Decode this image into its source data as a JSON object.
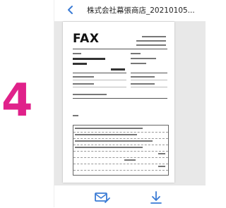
{
  "step": {
    "number": "4",
    "color": "#e0218a"
  },
  "header": {
    "back_icon": "chevron-left-icon",
    "title": "株式会社幕張商店_20210105..."
  },
  "document": {
    "heading": "FAX"
  },
  "toolbar": {
    "mail_icon": "mail-edit-icon",
    "download_icon": "download-icon",
    "accent": "#3a7bd5"
  }
}
